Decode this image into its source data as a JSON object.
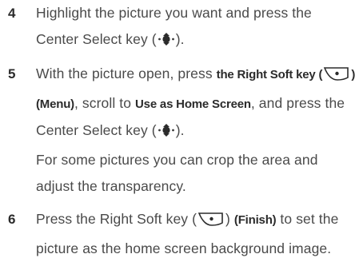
{
  "steps": [
    {
      "number": "4",
      "line1": "Highlight the picture you want and press the",
      "line2_pre": "Center Select key (",
      "line2_post": ")."
    },
    {
      "number": "5",
      "line1_pre": "With the picture open, press ",
      "line1_bold": "the Right Soft key (",
      "line1_bold_close": ")",
      "line2_bold": "(Menu)",
      "line2_mid": ", scroll to ",
      "line2_bold2": "Use as Home Screen",
      "line2_post": ", and press the",
      "line3_pre": "Center Select key (",
      "line3_post": ")."
    },
    {
      "line1": "For some pictures you can crop the area and",
      "line2": "adjust the transparency."
    },
    {
      "number": "6",
      "line1_pre": "Press the Right Soft key (",
      "line1_mid": ") ",
      "line1_bold": "(Finish)",
      "line1_post": " to set the",
      "line2": "picture as the home screen background image."
    }
  ]
}
